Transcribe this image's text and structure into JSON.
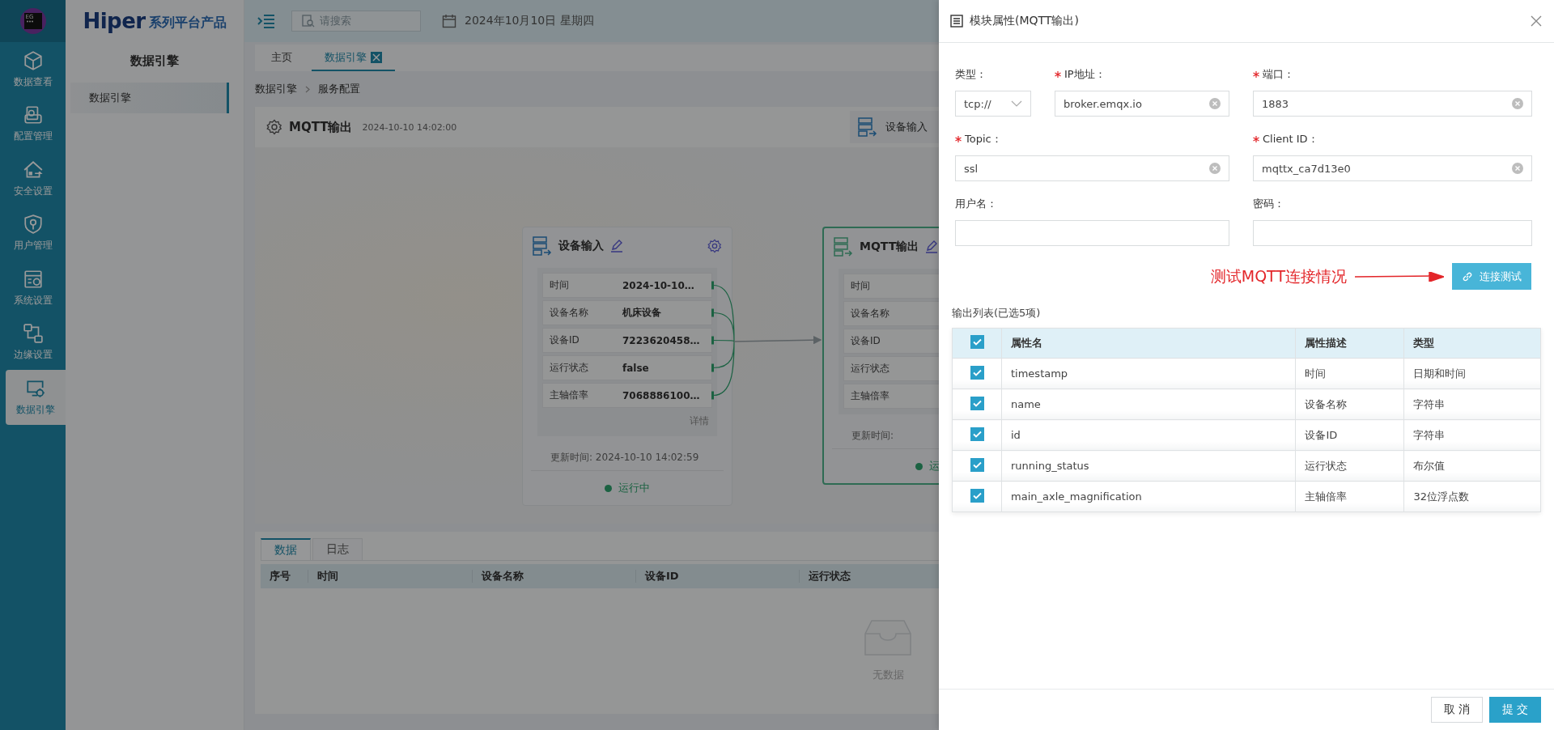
{
  "rail_logo": {
    "text": "EG"
  },
  "rail": [
    {
      "label": "数据查看",
      "selected": false
    },
    {
      "label": "配置管理",
      "selected": false
    },
    {
      "label": "安全设置",
      "selected": false
    },
    {
      "label": "用户管理",
      "selected": false
    },
    {
      "label": "系统设置",
      "selected": false
    },
    {
      "label": "边缘设置",
      "selected": false
    },
    {
      "label": "数据引擎",
      "selected": true
    }
  ],
  "sidebar": {
    "brand": "Hiper",
    "tagline": "系列平台产品",
    "title": "数据引擎",
    "items": [
      {
        "label": "数据引擎",
        "selected": true
      }
    ]
  },
  "header": {
    "search_placeholder": "请搜索",
    "date": "2024年10月10日 星期四"
  },
  "tabs": [
    {
      "label": "主页",
      "selected": false,
      "closable": false
    },
    {
      "label": "数据引擎",
      "selected": true,
      "closable": true
    }
  ],
  "breadcrumb": [
    "数据引擎",
    "服务配置"
  ],
  "module": {
    "title": "MQTT输出",
    "timestamp": "2024-10-10 14:02:00",
    "action": "设备输入"
  },
  "nodes": [
    {
      "title": "设备输入",
      "selected": false,
      "rows": [
        {
          "label": "时间",
          "value": "2024-10-10…"
        },
        {
          "label": "设备名称",
          "value": "机床设备"
        },
        {
          "label": "设备ID",
          "value": "7223620458…"
        },
        {
          "label": "运行状态",
          "value": "false"
        },
        {
          "label": "主轴倍率",
          "value": "7068886100…"
        }
      ],
      "detail_link": "详情",
      "updated": "更新时间: 2024-10-10 14:02:59",
      "status": "运行中"
    },
    {
      "title": "MQTT输出",
      "selected": true,
      "rows": [
        {
          "label": "时间"
        },
        {
          "label": "设备名称"
        },
        {
          "label": "设备ID"
        },
        {
          "label": "运行状态"
        },
        {
          "label": "主轴倍率"
        }
      ],
      "updated": "更新时间:",
      "status": "运"
    }
  ],
  "bottom_panel": {
    "tabs": [
      {
        "label": "数据",
        "selected": true
      },
      {
        "label": "日志",
        "selected": false
      }
    ],
    "columns": [
      "序号",
      "时间",
      "设备名称",
      "设备ID",
      "运行状态"
    ],
    "empty_text": "无数据"
  },
  "drawer": {
    "title": "模块属性(MQTT输出)",
    "fields": [
      {
        "label": "类型：",
        "required": false,
        "kind": "select",
        "value": "tcp://"
      },
      {
        "label": "IP地址：",
        "required": true,
        "kind": "text",
        "value": "broker.emqx.io"
      },
      {
        "label": "端口：",
        "required": true,
        "kind": "text",
        "value": "1883"
      },
      {
        "label": "Topic：",
        "required": true,
        "kind": "text",
        "value": "ssl"
      },
      {
        "label": "Client ID：",
        "required": true,
        "kind": "text",
        "value": "mqttx_ca7d13e0"
      },
      {
        "label": "用户名：",
        "required": false,
        "kind": "text"
      },
      {
        "label": "密码：",
        "required": false,
        "kind": "text"
      }
    ],
    "annotation": "测试MQTT连接情况",
    "test_button": "连接测试",
    "output_list": {
      "caption": "输出列表(已选5项)",
      "all_checked": true,
      "columns": [
        "属性名",
        "属性描述",
        "类型"
      ],
      "rows": [
        {
          "checked": true,
          "name": "timestamp",
          "description": "时间",
          "type": "日期和时间"
        },
        {
          "checked": true,
          "name": "name",
          "description": "设备名称",
          "type": "字符串"
        },
        {
          "checked": true,
          "name": "id",
          "description": "设备ID",
          "type": "字符串"
        },
        {
          "checked": true,
          "name": "running_status",
          "description": "运行状态",
          "type": "布尔值"
        },
        {
          "checked": true,
          "name": "main_axle_magnification",
          "description": "主轴倍率",
          "type": "32位浮点数"
        }
      ]
    },
    "footer_buttons": [
      {
        "label": "取 消",
        "kind": "secondary"
      },
      {
        "label": "提 交",
        "kind": "primary"
      }
    ]
  }
}
